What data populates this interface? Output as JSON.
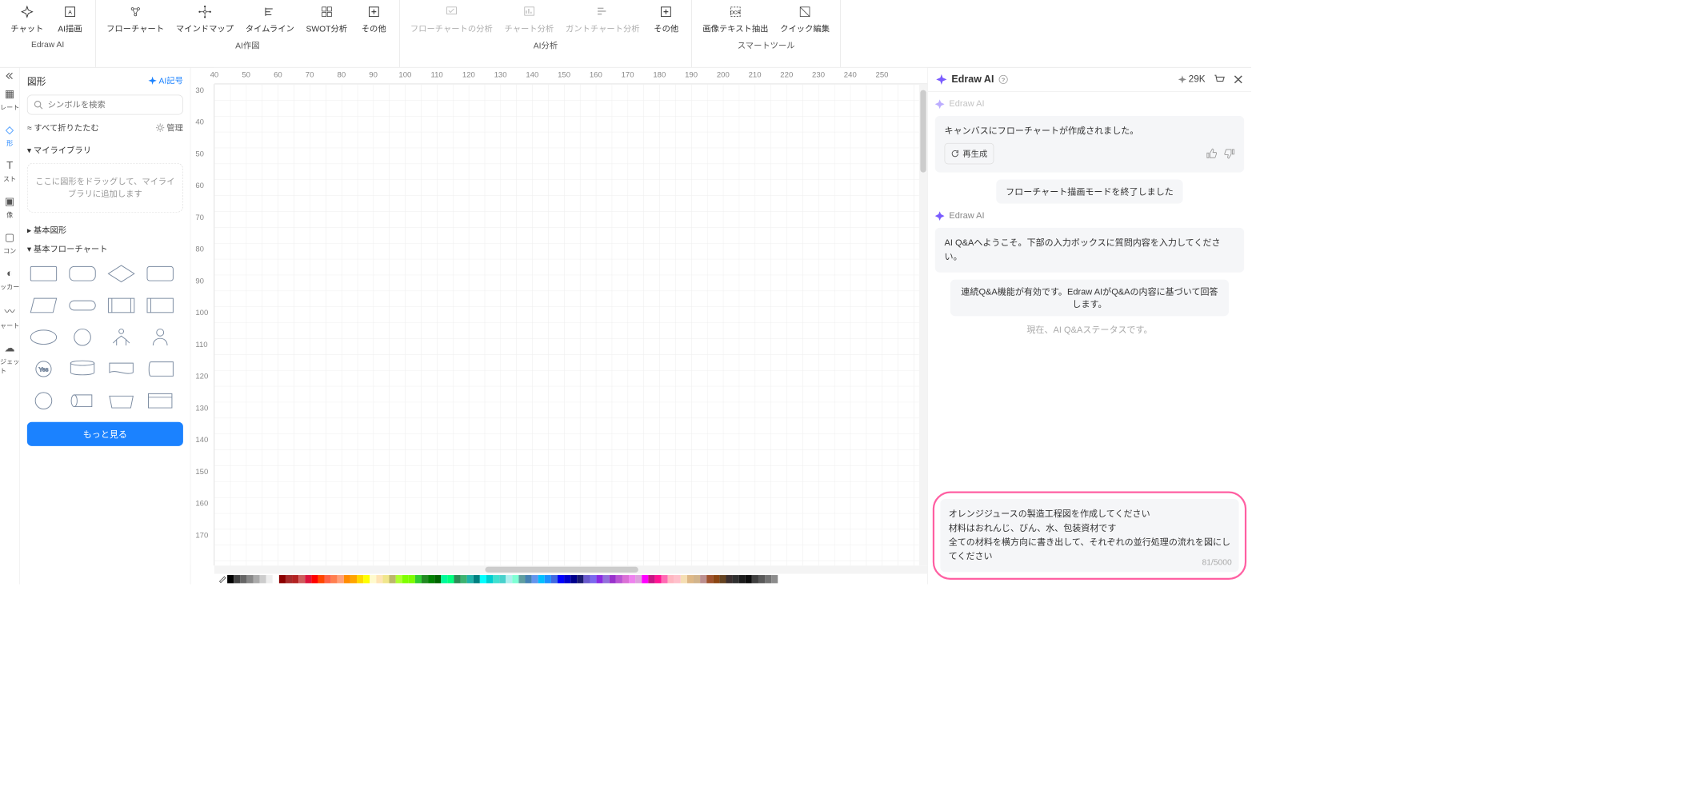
{
  "toolbar": {
    "groups": [
      {
        "label": "Edraw AI",
        "items": [
          {
            "icon": "sparkle",
            "label": "チャット"
          },
          {
            "icon": "image-ai",
            "label": "AI描画"
          }
        ]
      },
      {
        "label": "AI作図",
        "items": [
          {
            "icon": "flowchart",
            "label": "フローチャート"
          },
          {
            "icon": "mindmap",
            "label": "マインドマップ"
          },
          {
            "icon": "timeline",
            "label": "タイムライン"
          },
          {
            "icon": "swot",
            "label": "SWOT分析"
          },
          {
            "icon": "plus",
            "label": "その他"
          }
        ]
      },
      {
        "label": "AI分析",
        "items": [
          {
            "icon": "flow-an",
            "label": "フローチャートの分析",
            "disabled": true
          },
          {
            "icon": "chart-an",
            "label": "チャート分析",
            "disabled": true
          },
          {
            "icon": "gantt",
            "label": "ガントチャート分析",
            "disabled": true
          },
          {
            "icon": "plus",
            "label": "その他"
          }
        ]
      },
      {
        "label": "スマートツール",
        "items": [
          {
            "icon": "ocr",
            "label": "画像テキスト抽出"
          },
          {
            "icon": "quick",
            "label": "クイック編集"
          }
        ]
      }
    ]
  },
  "rail": [
    {
      "icon": "grid",
      "label": "レート"
    },
    {
      "icon": "shape",
      "label": "形",
      "active": true
    },
    {
      "icon": "text",
      "label": "スト"
    },
    {
      "icon": "image",
      "label": "像"
    },
    {
      "icon": "box",
      "label": "コン"
    },
    {
      "icon": "palette",
      "label": "ッカー"
    },
    {
      "icon": "chart",
      "label": "ャート"
    },
    {
      "icon": "cloud",
      "label": "ジェット"
    }
  ],
  "sidebar": {
    "title": "図形",
    "ai_link": "AI記号",
    "search_placeholder": "シンボルを検索",
    "fold_all": "すべて折りたたむ",
    "manage": "管理",
    "sections": {
      "mylib": "マイライブラリ",
      "dropzone": "ここに図形をドラッグして、マイライブラリに追加します",
      "basic_shapes": "基本図形",
      "basic_flow": "基本フローチャート"
    },
    "more": "もっと見る"
  },
  "ruler_h_start": 40,
  "ruler_h_end": 250,
  "ruler_v_start": 30,
  "ruler_v_end": 170,
  "color_row": [
    "#000",
    "#444",
    "#666",
    "#888",
    "#aaa",
    "#ccc",
    "#eee",
    "#fff",
    "#8b0000",
    "#a52a2a",
    "#b22222",
    "#cd5c5c",
    "#dc143c",
    "#ff0000",
    "#ff4500",
    "#ff6347",
    "#ff7f50",
    "#ffa07a",
    "#ff8c00",
    "#ffa500",
    "#ffd700",
    "#ffff00",
    "#fffacd",
    "#ffe4b5",
    "#f0e68c",
    "#bdb76b",
    "#adff2f",
    "#7fff00",
    "#7cfc00",
    "#32cd32",
    "#228b22",
    "#008000",
    "#006400",
    "#00fa9a",
    "#00ff7f",
    "#2e8b57",
    "#3cb371",
    "#20b2aa",
    "#008080",
    "#00ffff",
    "#00ced1",
    "#40e0d0",
    "#48d1cc",
    "#afeeee",
    "#7fffd4",
    "#5f9ea0",
    "#4682b4",
    "#6495ed",
    "#00bfff",
    "#1e90ff",
    "#4169e1",
    "#0000ff",
    "#0000cd",
    "#00008b",
    "#191970",
    "#6a5acd",
    "#7b68ee",
    "#8a2be2",
    "#9370db",
    "#9932cc",
    "#ba55d3",
    "#da70d6",
    "#ee82ee",
    "#dda0dd",
    "#ff00ff",
    "#c71585",
    "#ff1493",
    "#ff69b4",
    "#ffb6c1",
    "#ffc0cb",
    "#f5deb3",
    "#deb887",
    "#d2b48c",
    "#bc8f8f",
    "#a0522d",
    "#8b4513",
    "#654321",
    "#3b2f2f",
    "#2f2f2f",
    "#1a1a1a",
    "#0d0d0d",
    "#404040",
    "#595959",
    "#737373",
    "#8c8c8c"
  ],
  "ai": {
    "title": "Edraw AI",
    "credits": "29K",
    "from": "Edraw AI",
    "msg1": "キャンバスにフローチャートが作成されました。",
    "regen": "再生成",
    "notice1": "フローチャート描画モードを終了しました",
    "welcome": "AI Q&Aへようこそ。下部の入力ボックスに質問内容を入力してください。",
    "notice2": "連続Q&A機能が有効です。Edraw AIがQ&Aの内容に基づいて回答します。",
    "status": "現在、AI Q&Aステータスです。",
    "input_l1": "オレンジジュースの製造工程図を作成してください",
    "input_l2": "材料はおれんじ、びん、水、包装資材です",
    "input_l3": "全ての材料を横方向に書き出して、それぞれの並行処理の流れを図にしてください",
    "char_count": "81/5000"
  }
}
